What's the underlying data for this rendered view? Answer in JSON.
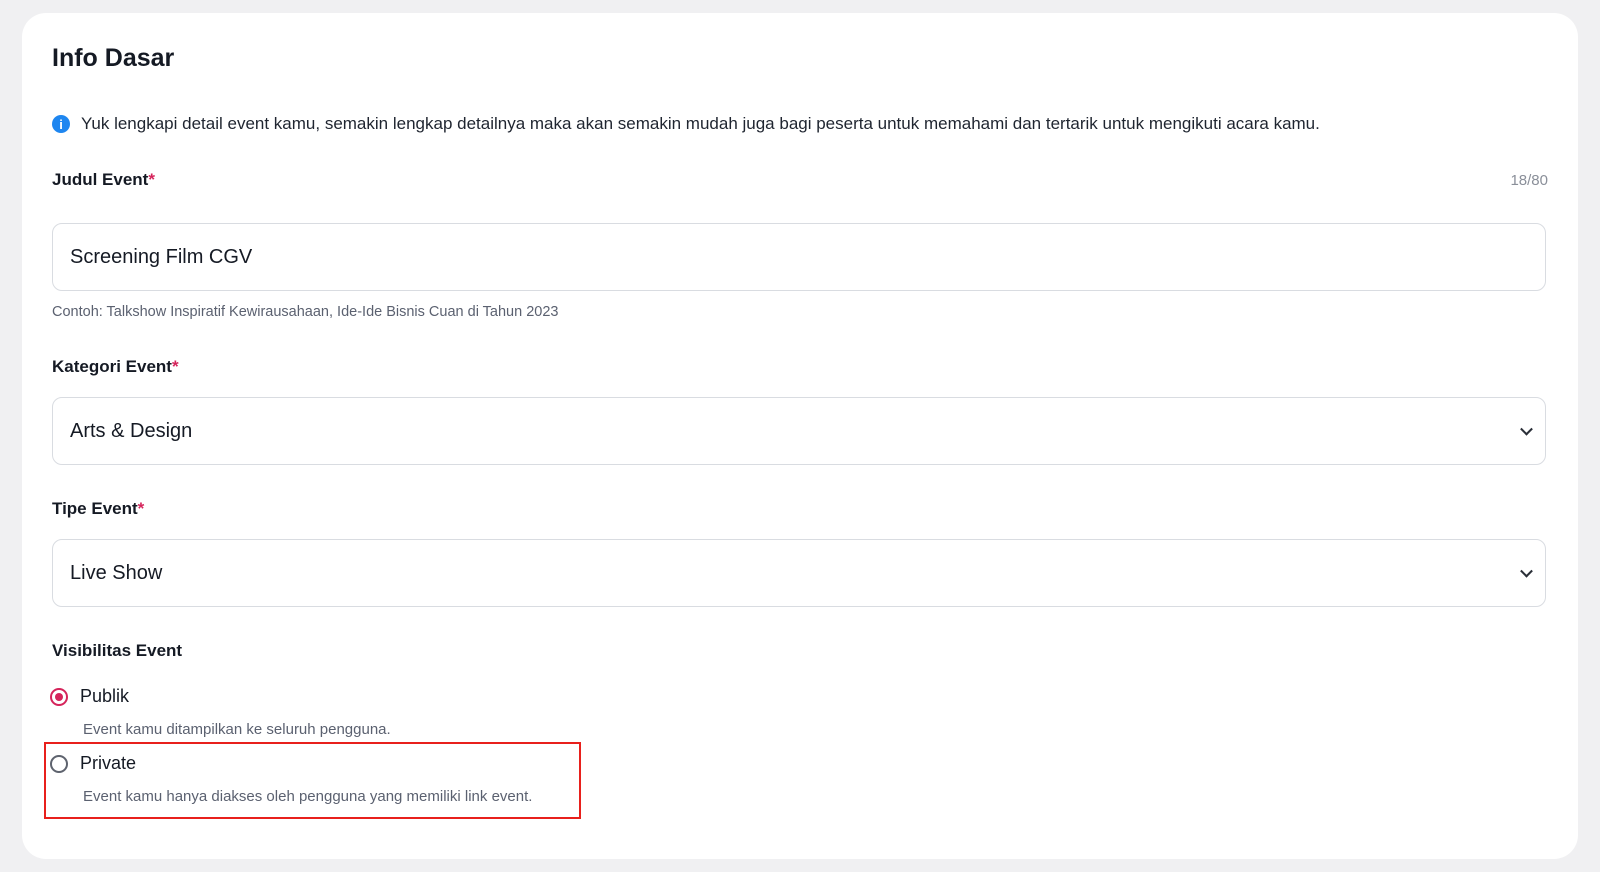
{
  "section": {
    "title": "Info Dasar",
    "info_text": "Yuk lengkapi detail event kamu, semakin lengkap detailnya maka akan semakin mudah juga bagi peserta untuk memahami dan tertarik untuk mengikuti acara kamu."
  },
  "judul": {
    "label": "Judul Event",
    "required_mark": "*",
    "counter": "18/80",
    "value": "Screening Film CGV",
    "hint": "Contoh: Talkshow Inspiratif Kewirausahaan, Ide-Ide Bisnis Cuan di Tahun 2023"
  },
  "kategori": {
    "label": "Kategori Event",
    "required_mark": "*",
    "value": "Arts & Design"
  },
  "tipe": {
    "label": "Tipe Event",
    "required_mark": "*",
    "value": "Live Show"
  },
  "visibilitas": {
    "label": "Visibilitas Event",
    "options": [
      {
        "label": "Publik",
        "description": "Event kamu ditampilkan ke seluruh pengguna.",
        "selected": true
      },
      {
        "label": "Private",
        "description": "Event kamu hanya diakses oleh pengguna yang memiliki link event.",
        "selected": false
      }
    ]
  },
  "colors": {
    "accent": "#d5245b",
    "info": "#1e86f0",
    "highlight_box": "#e8201c"
  },
  "icons": {
    "info": "info-icon",
    "dropdown": "chevron-down-icon"
  }
}
